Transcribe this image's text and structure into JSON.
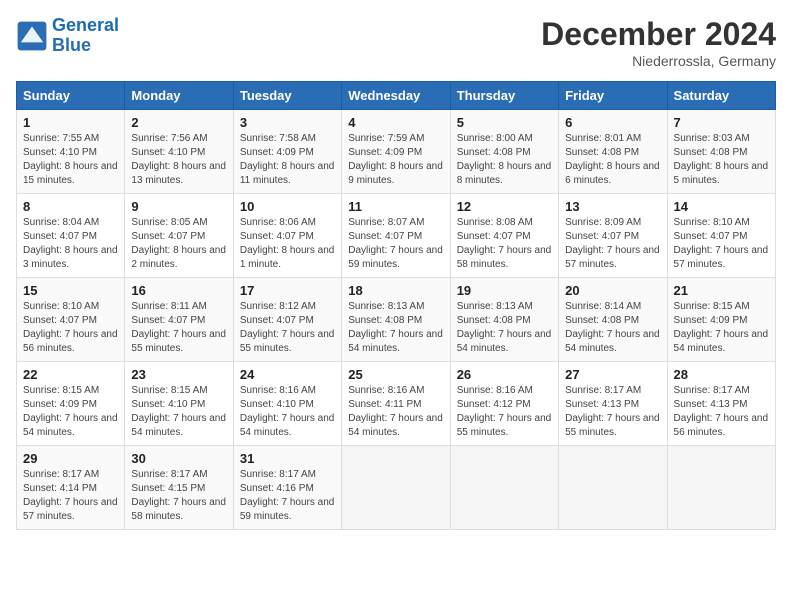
{
  "header": {
    "logo_line1": "General",
    "logo_line2": "Blue",
    "month_year": "December 2024",
    "location": "Niederrossla, Germany"
  },
  "weekdays": [
    "Sunday",
    "Monday",
    "Tuesday",
    "Wednesday",
    "Thursday",
    "Friday",
    "Saturday"
  ],
  "weeks": [
    [
      {
        "day": "1",
        "info": "Sunrise: 7:55 AM\nSunset: 4:10 PM\nDaylight: 8 hours and 15 minutes."
      },
      {
        "day": "2",
        "info": "Sunrise: 7:56 AM\nSunset: 4:10 PM\nDaylight: 8 hours and 13 minutes."
      },
      {
        "day": "3",
        "info": "Sunrise: 7:58 AM\nSunset: 4:09 PM\nDaylight: 8 hours and 11 minutes."
      },
      {
        "day": "4",
        "info": "Sunrise: 7:59 AM\nSunset: 4:09 PM\nDaylight: 8 hours and 9 minutes."
      },
      {
        "day": "5",
        "info": "Sunrise: 8:00 AM\nSunset: 4:08 PM\nDaylight: 8 hours and 8 minutes."
      },
      {
        "day": "6",
        "info": "Sunrise: 8:01 AM\nSunset: 4:08 PM\nDaylight: 8 hours and 6 minutes."
      },
      {
        "day": "7",
        "info": "Sunrise: 8:03 AM\nSunset: 4:08 PM\nDaylight: 8 hours and 5 minutes."
      }
    ],
    [
      {
        "day": "8",
        "info": "Sunrise: 8:04 AM\nSunset: 4:07 PM\nDaylight: 8 hours and 3 minutes."
      },
      {
        "day": "9",
        "info": "Sunrise: 8:05 AM\nSunset: 4:07 PM\nDaylight: 8 hours and 2 minutes."
      },
      {
        "day": "10",
        "info": "Sunrise: 8:06 AM\nSunset: 4:07 PM\nDaylight: 8 hours and 1 minute."
      },
      {
        "day": "11",
        "info": "Sunrise: 8:07 AM\nSunset: 4:07 PM\nDaylight: 7 hours and 59 minutes."
      },
      {
        "day": "12",
        "info": "Sunrise: 8:08 AM\nSunset: 4:07 PM\nDaylight: 7 hours and 58 minutes."
      },
      {
        "day": "13",
        "info": "Sunrise: 8:09 AM\nSunset: 4:07 PM\nDaylight: 7 hours and 57 minutes."
      },
      {
        "day": "14",
        "info": "Sunrise: 8:10 AM\nSunset: 4:07 PM\nDaylight: 7 hours and 57 minutes."
      }
    ],
    [
      {
        "day": "15",
        "info": "Sunrise: 8:10 AM\nSunset: 4:07 PM\nDaylight: 7 hours and 56 minutes."
      },
      {
        "day": "16",
        "info": "Sunrise: 8:11 AM\nSunset: 4:07 PM\nDaylight: 7 hours and 55 minutes."
      },
      {
        "day": "17",
        "info": "Sunrise: 8:12 AM\nSunset: 4:07 PM\nDaylight: 7 hours and 55 minutes."
      },
      {
        "day": "18",
        "info": "Sunrise: 8:13 AM\nSunset: 4:08 PM\nDaylight: 7 hours and 54 minutes."
      },
      {
        "day": "19",
        "info": "Sunrise: 8:13 AM\nSunset: 4:08 PM\nDaylight: 7 hours and 54 minutes."
      },
      {
        "day": "20",
        "info": "Sunrise: 8:14 AM\nSunset: 4:08 PM\nDaylight: 7 hours and 54 minutes."
      },
      {
        "day": "21",
        "info": "Sunrise: 8:15 AM\nSunset: 4:09 PM\nDaylight: 7 hours and 54 minutes."
      }
    ],
    [
      {
        "day": "22",
        "info": "Sunrise: 8:15 AM\nSunset: 4:09 PM\nDaylight: 7 hours and 54 minutes."
      },
      {
        "day": "23",
        "info": "Sunrise: 8:15 AM\nSunset: 4:10 PM\nDaylight: 7 hours and 54 minutes."
      },
      {
        "day": "24",
        "info": "Sunrise: 8:16 AM\nSunset: 4:10 PM\nDaylight: 7 hours and 54 minutes."
      },
      {
        "day": "25",
        "info": "Sunrise: 8:16 AM\nSunset: 4:11 PM\nDaylight: 7 hours and 54 minutes."
      },
      {
        "day": "26",
        "info": "Sunrise: 8:16 AM\nSunset: 4:12 PM\nDaylight: 7 hours and 55 minutes."
      },
      {
        "day": "27",
        "info": "Sunrise: 8:17 AM\nSunset: 4:13 PM\nDaylight: 7 hours and 55 minutes."
      },
      {
        "day": "28",
        "info": "Sunrise: 8:17 AM\nSunset: 4:13 PM\nDaylight: 7 hours and 56 minutes."
      }
    ],
    [
      {
        "day": "29",
        "info": "Sunrise: 8:17 AM\nSunset: 4:14 PM\nDaylight: 7 hours and 57 minutes."
      },
      {
        "day": "30",
        "info": "Sunrise: 8:17 AM\nSunset: 4:15 PM\nDaylight: 7 hours and 58 minutes."
      },
      {
        "day": "31",
        "info": "Sunrise: 8:17 AM\nSunset: 4:16 PM\nDaylight: 7 hours and 59 minutes."
      },
      null,
      null,
      null,
      null
    ]
  ]
}
